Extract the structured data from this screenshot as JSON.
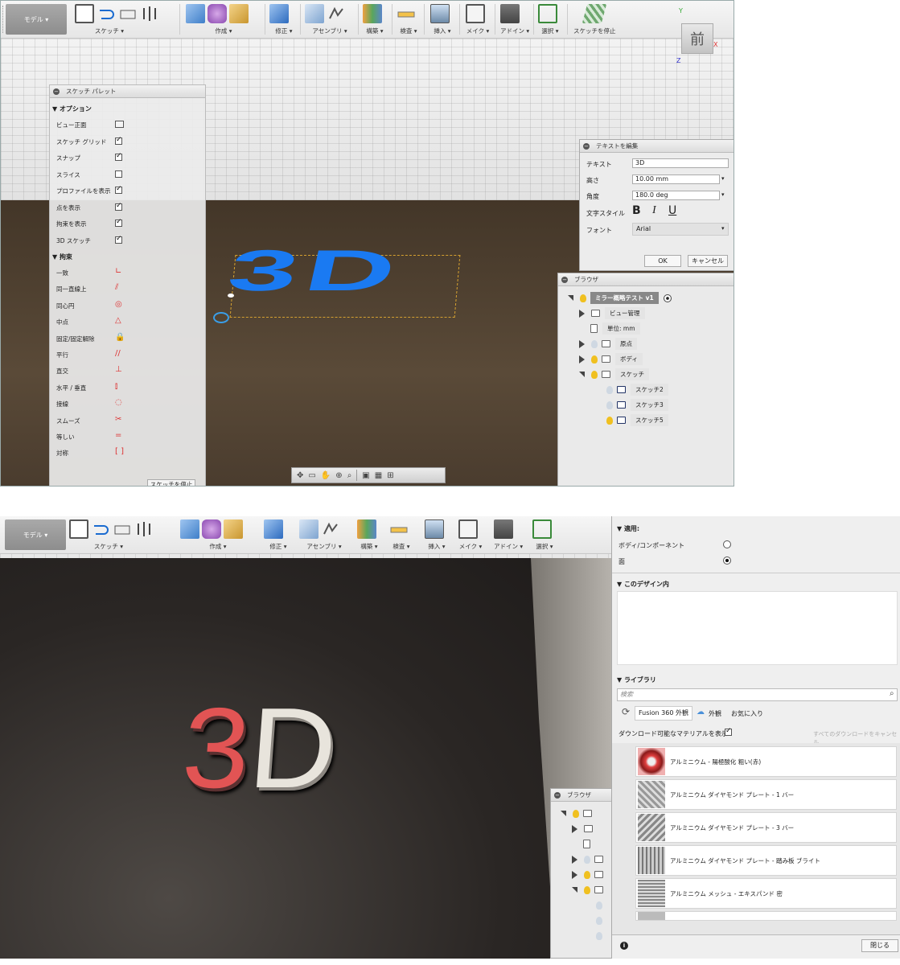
{
  "toolbar": {
    "mode": "モデル ▾",
    "groups": {
      "sketch": "スケッチ ▾",
      "create": "作成 ▾",
      "modify": "修正 ▾",
      "assemble": "アセンブリ ▾",
      "construct": "構築 ▾",
      "inspect": "検査 ▾",
      "insert": "挿入 ▾",
      "make": "メイク ▾",
      "addins": "アドイン ▾",
      "select": "選択 ▾",
      "stop_sketch": "スケッチを停止"
    }
  },
  "viewcube": {
    "face": "前",
    "x": "X",
    "y": "Y",
    "z": "Z"
  },
  "sketch_palette": {
    "title": "スケッチ パレット",
    "options_header": "▼ オプション",
    "options": [
      {
        "label": "ビュー正面"
      },
      {
        "label": "スケッチ グリッド",
        "checked": true
      },
      {
        "label": "スナップ",
        "checked": true
      },
      {
        "label": "スライス",
        "checked": false
      },
      {
        "label": "プロファイルを表示",
        "checked": true
      },
      {
        "label": "点を表示",
        "checked": true
      },
      {
        "label": "拘束を表示",
        "checked": true
      },
      {
        "label": "3D スケッチ",
        "checked": true
      }
    ],
    "constraints_header": "▼ 拘束",
    "constraints": [
      "一致",
      "同一直線上",
      "同心円",
      "中点",
      "固定/固定解除",
      "平行",
      "直交",
      "水平 / 垂直",
      "接線",
      "スムーズ",
      "等しい",
      "対称"
    ],
    "stop_button": "スケッチを停止"
  },
  "edit_text": {
    "title": "テキストを編集",
    "text_label": "テキスト",
    "text_value": "3D",
    "height_label": "高さ",
    "height_value": "10.00 mm",
    "angle_label": "角度",
    "angle_value": "180.0 deg",
    "style_label": "文字スタイル",
    "bold": "B",
    "italic": "I",
    "underline": "U",
    "font_label": "フォント",
    "font_value": "Arial",
    "ok": "OK",
    "cancel": "キャンセル"
  },
  "browser": {
    "title": "ブラウザ",
    "root": "ミラー概略テスト v1",
    "items": [
      "ビュー管理",
      "単位: mm",
      "原点",
      "ボディ",
      "スケッチ",
      "スケッチ2",
      "スケッチ3",
      "スケッチ5"
    ]
  },
  "canvas_text": "3D",
  "appearance": {
    "apply_header": "▼ 適用:",
    "apply_options": [
      "ボディ/コンポーネント",
      "面"
    ],
    "design_header": "▼ このデザイン内",
    "library_header": "▼ ライブラリ",
    "search_placeholder": "検索",
    "tabs": [
      "Fusion 360 外観",
      "外観",
      "お気に入り"
    ],
    "download_label": "ダウンロード可能なマテリアルを表示",
    "cancel_all": "すべてのダウンロードをキャンセル",
    "materials": [
      "アルミニウム - 陽極酸化 粗い(赤)",
      "アルミニウム ダイヤモンド プレート - 1 バー",
      "アルミニウム ダイヤモンド プレート - 3 バー",
      "アルミニウム ダイヤモンド プレート - 踏み板 ブライト",
      "アルミニウム メッシュ - エキスパンド 密"
    ],
    "close": "閉じる",
    "info": "i"
  },
  "browser2_title": "ブラウザ"
}
